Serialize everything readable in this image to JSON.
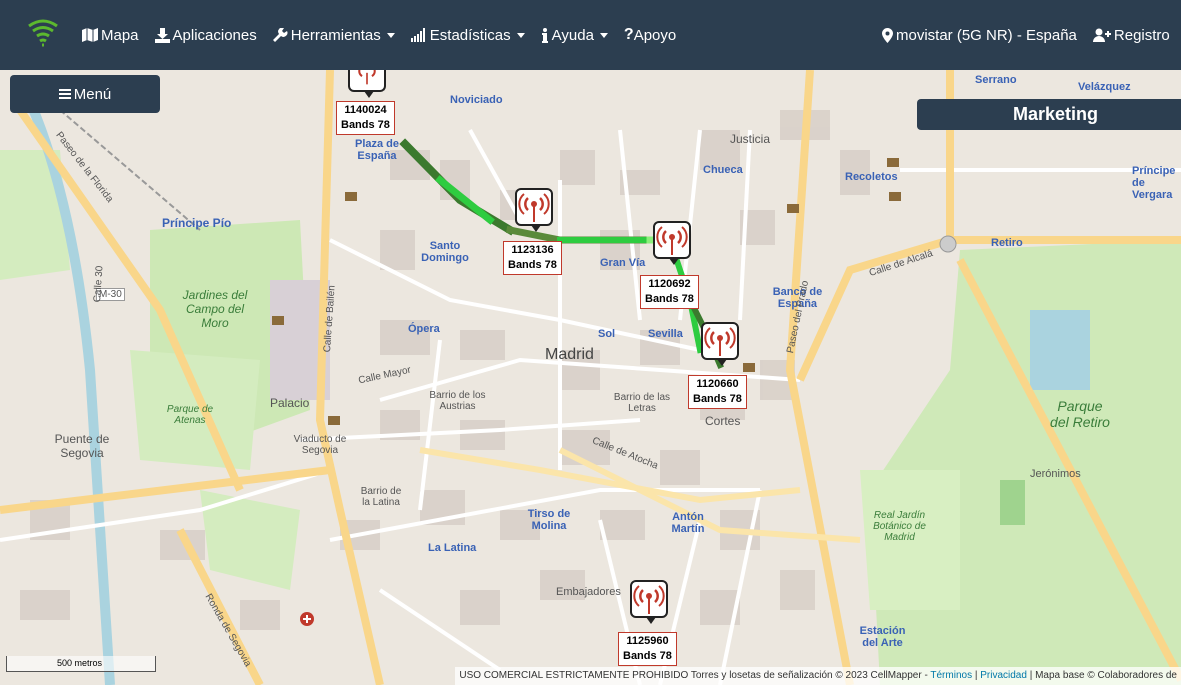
{
  "nav": {
    "items": [
      {
        "label": "Mapa",
        "icon": "map-icon"
      },
      {
        "label": "Aplicaciones",
        "icon": "download-icon"
      },
      {
        "label": "Herramientas",
        "icon": "wrench-icon",
        "dropdown": true
      },
      {
        "label": "Estadísticas",
        "icon": "signal-bars-icon",
        "dropdown": true
      },
      {
        "label": "Ayuda",
        "icon": "info-icon",
        "dropdown": true
      },
      {
        "label": "Apoyo",
        "icon": "question-icon"
      }
    ],
    "network": "movistar (5G NR) - España",
    "register": "Registro"
  },
  "menu_button": "Menú",
  "marketing": "Marketing",
  "towers": [
    {
      "id": "1140024",
      "bands": "Bands 78"
    },
    {
      "id": "1123136",
      "bands": "Bands 78"
    },
    {
      "id": "1120692",
      "bands": "Bands 78"
    },
    {
      "id": "1120660",
      "bands": "Bands 78"
    },
    {
      "id": "1125960",
      "bands": "Bands 78"
    }
  ],
  "map_labels": {
    "madrid": "Madrid",
    "noviciado": "Noviciado",
    "plaza_espana": "Plaza de España",
    "principe_pio": "Príncipe Pío",
    "santo_domingo": "Santo Domingo",
    "gran_via": "Gran Vía",
    "chueca": "Chueca",
    "justicia": "Justicia",
    "banco_espana": "Banco de España",
    "sevilla": "Sevilla",
    "sol": "Sol",
    "opera": "Ópera",
    "palacio": "Palacio",
    "barrio_austrias": "Barrio de los Austrias",
    "barrio_letras": "Barrio de las Letras",
    "cortes": "Cortes",
    "recoletos": "Recoletos",
    "retiro": "Retiro",
    "parque_retiro": "Parque del Retiro",
    "jardines_moro": "Jardines del Campo del Moro",
    "parque_atenas": "Parque de Atenas",
    "puente_segovia": "Puente de Segovia",
    "viaducto": "Viaducto de Segovia",
    "barrio_latina": "Barrio de la Latina",
    "la_latina": "La Latina",
    "tirso": "Tirso de Molina",
    "anton_martin": "Antón Martín",
    "embajadores": "Embajadores",
    "estacion_arte": "Estación del Arte",
    "jeronimos": "Jerónimos",
    "jardin_botanico": "Real Jardín Botánico de Madrid",
    "serrano": "Serrano",
    "velazquez": "Velázquez",
    "principe_vergara": "Príncipe de Vergara",
    "paseo_prado": "Paseo del Prado",
    "calle_alcala": "Calle de Alcalá",
    "calle_mayor": "Calle Mayor",
    "calle_atocha": "Calle de Atocha",
    "calle_bailen": "Calle de Bailén",
    "paseo_florida": "Paseo de la Florida",
    "ronda_segovia": "Ronda de Segovia",
    "m30": "M-30",
    "calle_30": "Calle 30"
  },
  "scale": "500 metros",
  "attribution": {
    "text": "USO COMERCIAL ESTRICTAMENTE PROHIBIDO Torres y losetas de señalización © 2023 CellMapper - ",
    "terms": "Términos",
    "privacy": "Privacidad",
    "base": "Mapa base © Colaboradores de"
  },
  "colors": {
    "navbar": "#2c3e50",
    "tower_label_border": "#c0392b",
    "signal_dark": "#3b7a2e",
    "signal_bright": "#2ecc40",
    "park": "#c8e6b0",
    "road_major": "#f9d68a"
  }
}
